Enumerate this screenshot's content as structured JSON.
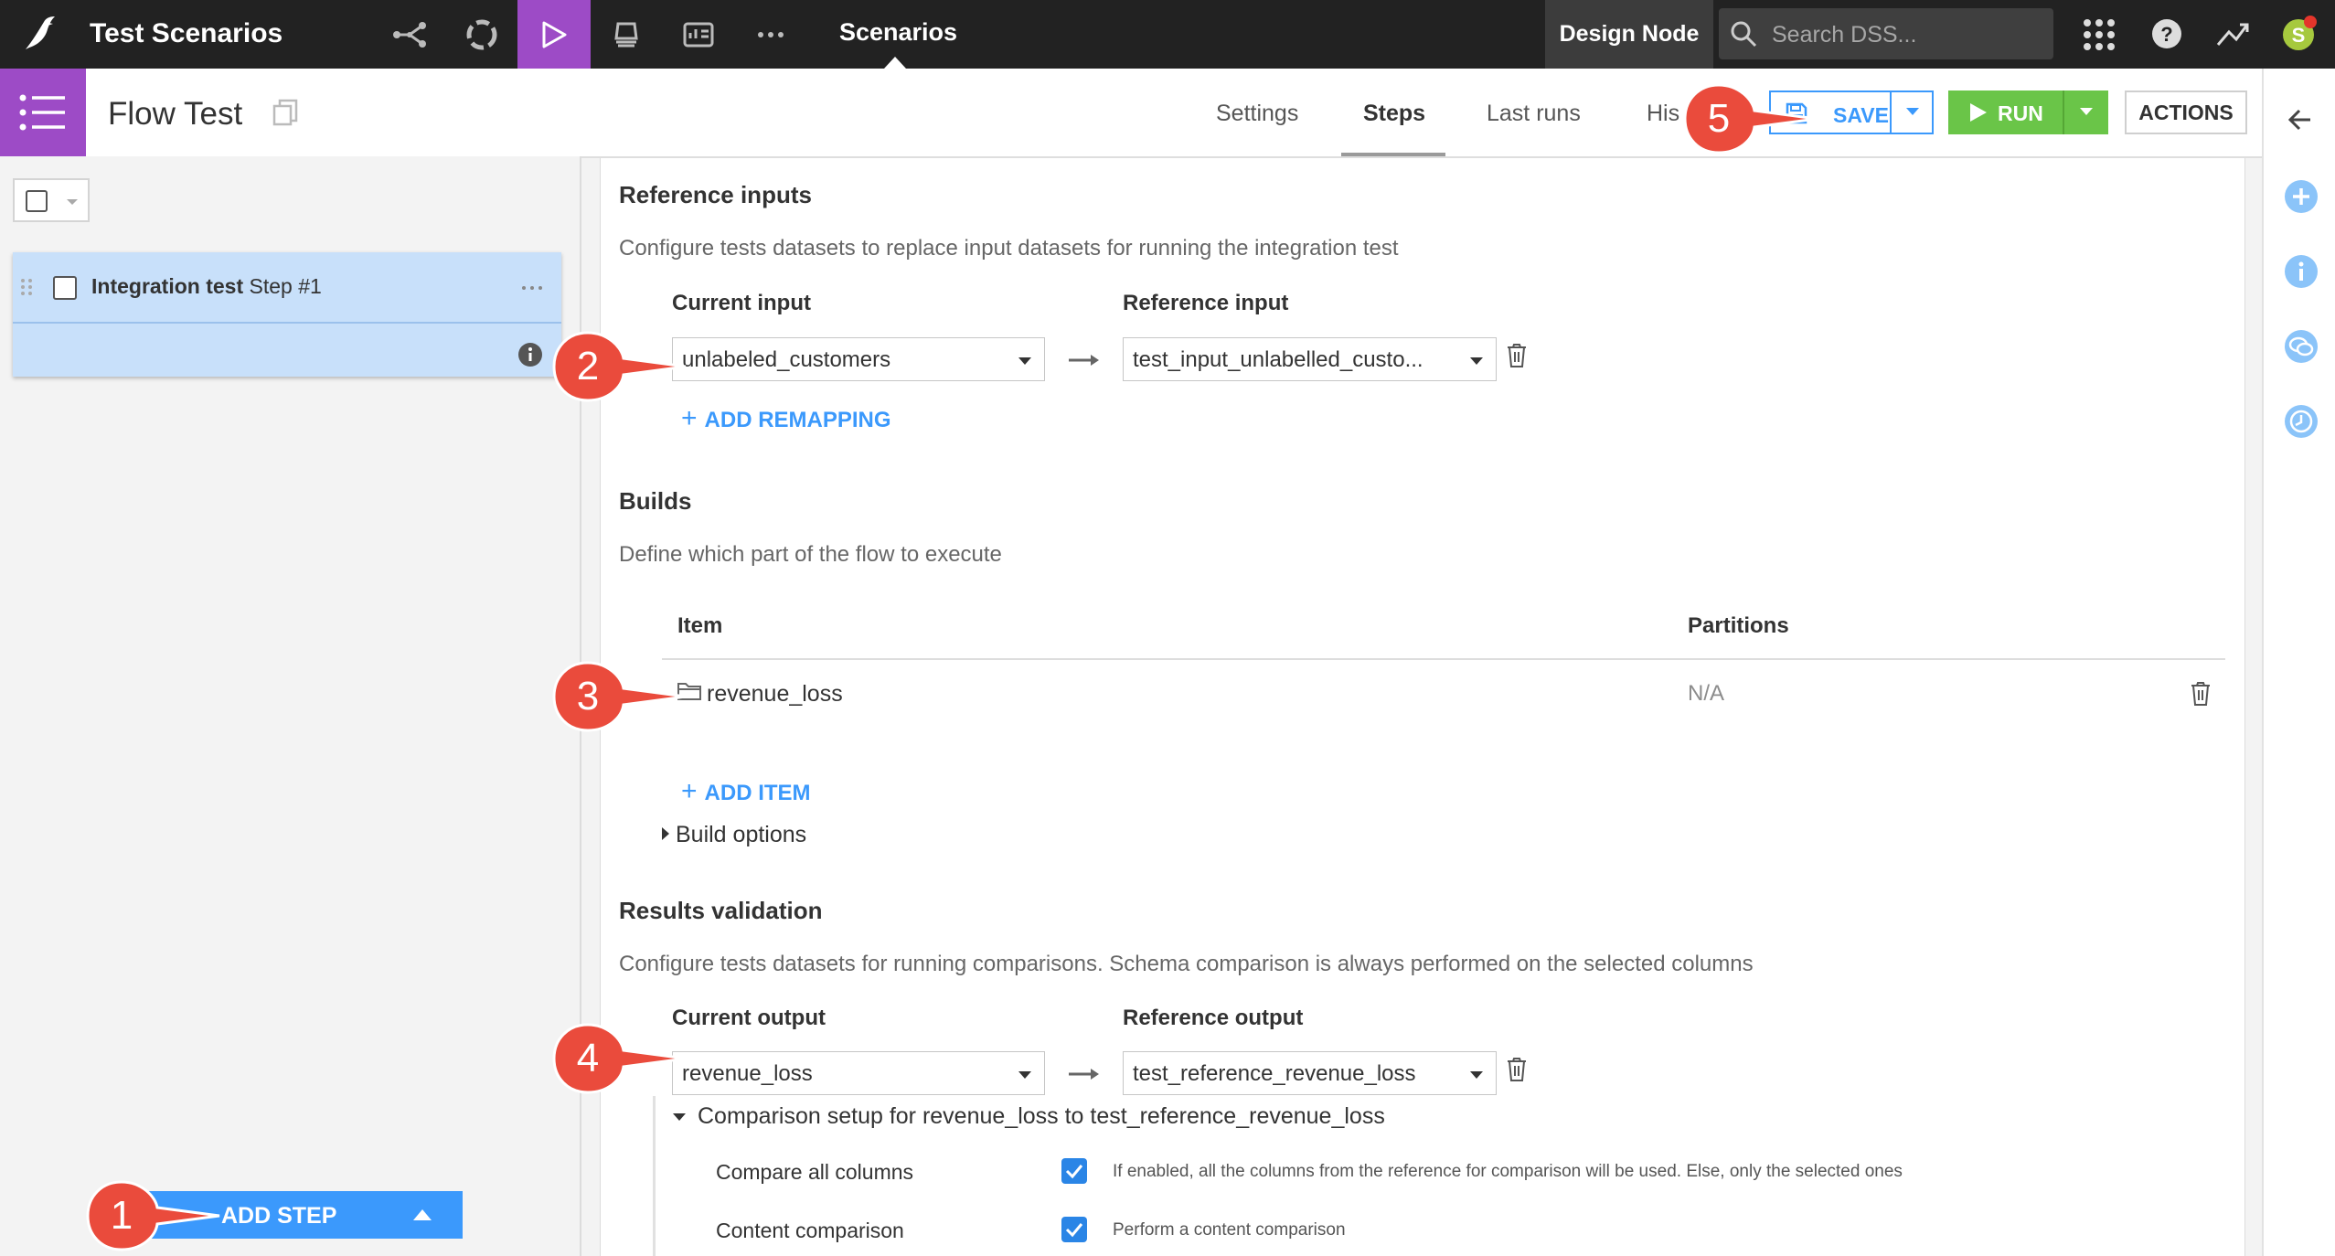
{
  "top_bar": {
    "project_title": "Test Scenarios",
    "active_section": "Scenarios",
    "node_label": "Design Node",
    "search_placeholder": "Search DSS..."
  },
  "sub_bar": {
    "scenario_name": "Flow Test",
    "tabs": [
      {
        "label": "Settings"
      },
      {
        "label": "Steps",
        "active": true
      },
      {
        "label": "Last runs"
      },
      {
        "label": "His"
      }
    ],
    "save_label": "SAVE",
    "run_label": "RUN",
    "actions_label": "ACTIONS"
  },
  "left_panel": {
    "steps": [
      {
        "type_label": "Integration test",
        "step_label": "Step #1"
      }
    ],
    "add_step_label": "ADD STEP"
  },
  "reference_inputs": {
    "title": "Reference inputs",
    "description": "Configure tests datasets to replace input datasets for running the integration test",
    "current_label": "Current input",
    "reference_label": "Reference input",
    "current_value": "unlabeled_customers",
    "reference_value": "test_input_unlabelled_custo...",
    "add_label": "ADD REMAPPING"
  },
  "builds": {
    "title": "Builds",
    "description": "Define which part of the flow to execute",
    "col_item": "Item",
    "col_partitions": "Partitions",
    "items": [
      {
        "name": "revenue_loss",
        "partitions": "N/A"
      }
    ],
    "add_label": "ADD ITEM",
    "options_label": "Build options"
  },
  "results_validation": {
    "title": "Results validation",
    "description": "Configure tests datasets for running comparisons. Schema comparison is always performed on the selected columns",
    "current_label": "Current output",
    "reference_label": "Reference output",
    "current_value": "revenue_loss",
    "reference_value": "test_reference_revenue_loss",
    "comparison_title": "Comparison setup for revenue_loss to test_reference_revenue_loss",
    "options": [
      {
        "label": "Compare all columns",
        "checked": true,
        "hint": "If enabled, all the columns from the reference for comparison will be used. Else, only the selected ones"
      },
      {
        "label": "Content comparison",
        "checked": true,
        "hint": "Perform a content comparison"
      }
    ]
  },
  "callouts": [
    "1",
    "2",
    "3",
    "4",
    "5"
  ],
  "colors": {
    "accent_purple": "#9d4bc6",
    "primary_blue": "#3b99fc",
    "run_green": "#6ac548",
    "callout_red": "#ea4b3c"
  },
  "icons": [
    "logo-bird-icon",
    "flow-icon",
    "lab-icon",
    "code-icon",
    "play-icon",
    "deploy-icon",
    "dashboard-icon",
    "more-icon",
    "search-icon",
    "apps-grid-icon",
    "help-icon",
    "activity-icon",
    "avatar",
    "menu-icon",
    "copy-icon",
    "save-icon",
    "play-icon",
    "back-arrow-icon",
    "add-circle-icon",
    "info-circle-icon",
    "chat-icon",
    "history-icon",
    "drag-handle-icon",
    "info-icon",
    "arrow-right-icon",
    "trash-icon",
    "folder-icon",
    "caret-right-icon",
    "caret-down-icon",
    "check-icon"
  ]
}
